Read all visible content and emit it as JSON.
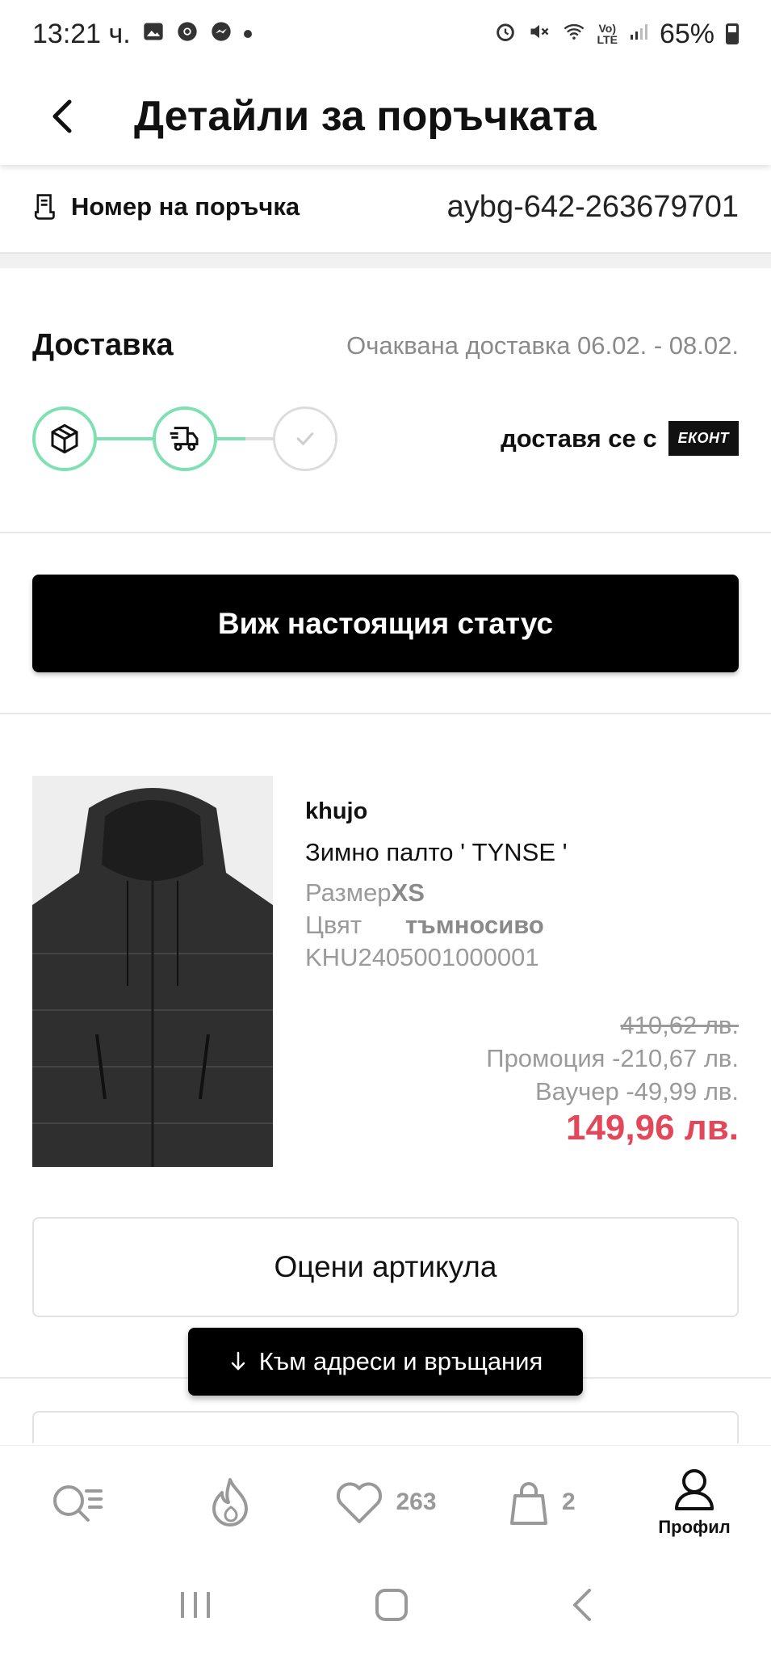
{
  "status_bar": {
    "time": "13:21 ч.",
    "battery": "65%",
    "icons": [
      "gallery-icon",
      "chrome-icon",
      "messenger-icon",
      "alarm-icon",
      "mute-icon",
      "wifi-icon",
      "volte-icon",
      "signal-icon",
      "battery-icon"
    ]
  },
  "header": {
    "title": "Детайли за поръчката"
  },
  "order": {
    "label": "Номер на поръчка",
    "value": "aybg-642-263679701"
  },
  "delivery": {
    "title": "Доставка",
    "expected": "Очаквана доставка 06.02. - 08.02.",
    "progress_steps": [
      {
        "icon": "package-icon",
        "state": "done"
      },
      {
        "icon": "delivery-truck-icon",
        "state": "current"
      },
      {
        "icon": "check-icon",
        "state": "pending"
      }
    ],
    "carrier_text": "доставя се с",
    "carrier_logo": "ЕКОНТ",
    "accent_color": "#7ee0b3"
  },
  "status_button": {
    "label": "Виж настоящия статус"
  },
  "product": {
    "brand": "khujo",
    "name": "Зимно палто ' TYNSE '",
    "size_label": "Размер",
    "size_value": "XS",
    "color_label": "Цвят",
    "color_value": "тъмносиво",
    "sku": "KHU2405001000001",
    "old_price": "410,62 лв.",
    "promotion": "Промоция -210,67 лв.",
    "voucher": "Ваучер -49,99 лв.",
    "final_price": "149,96 лв.",
    "final_price_color": "#e3485a"
  },
  "rate_button": {
    "label": "Оцени артикула"
  },
  "floating_button": {
    "label": "Към адреси и връщания"
  },
  "bottom_nav": {
    "items": [
      {
        "icon": "search-list-icon"
      },
      {
        "icon": "flame-icon"
      },
      {
        "icon": "heart-icon",
        "count": "263"
      },
      {
        "icon": "shopping-bag-icon",
        "count": "2"
      },
      {
        "icon": "profile-icon",
        "label": "Профил"
      }
    ]
  }
}
